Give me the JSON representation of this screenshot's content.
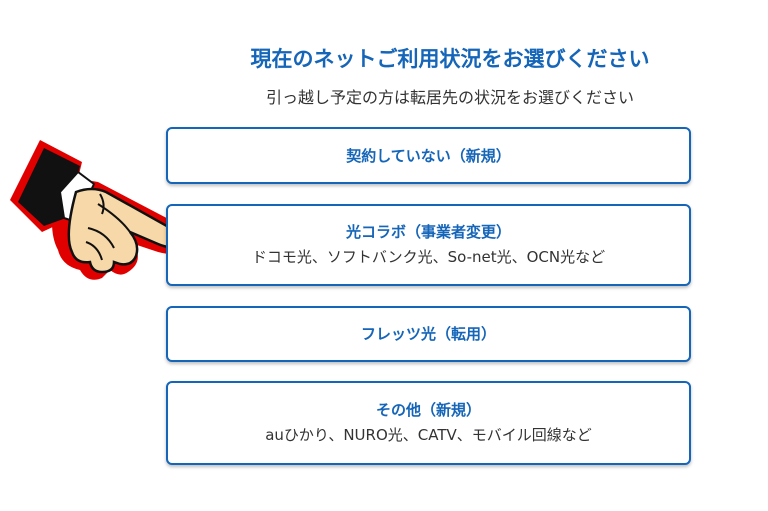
{
  "header": {
    "title": "現在のネットご利用状況をお選びください",
    "subtitle": "引っ越し予定の方は転居先の状況をお選びください"
  },
  "options": [
    {
      "title": "契約していない（新規）",
      "desc": ""
    },
    {
      "title": "光コラボ（事業者変更）",
      "desc": "ドコモ光、ソフトバンク光、So-net光、OCN光など"
    },
    {
      "title": "フレッツ光（転用）",
      "desc": ""
    },
    {
      "title": "その他（新規）",
      "desc": "auひかり、NURO光、CATV、モバイル回線など"
    }
  ],
  "colors": {
    "accent": "#1565b8",
    "text": "#333333",
    "hand_outline": "#e00000",
    "sleeve": "#111111",
    "skin": "#f7d8a8"
  },
  "icons": {
    "pointer": "pointing-hand-icon"
  }
}
